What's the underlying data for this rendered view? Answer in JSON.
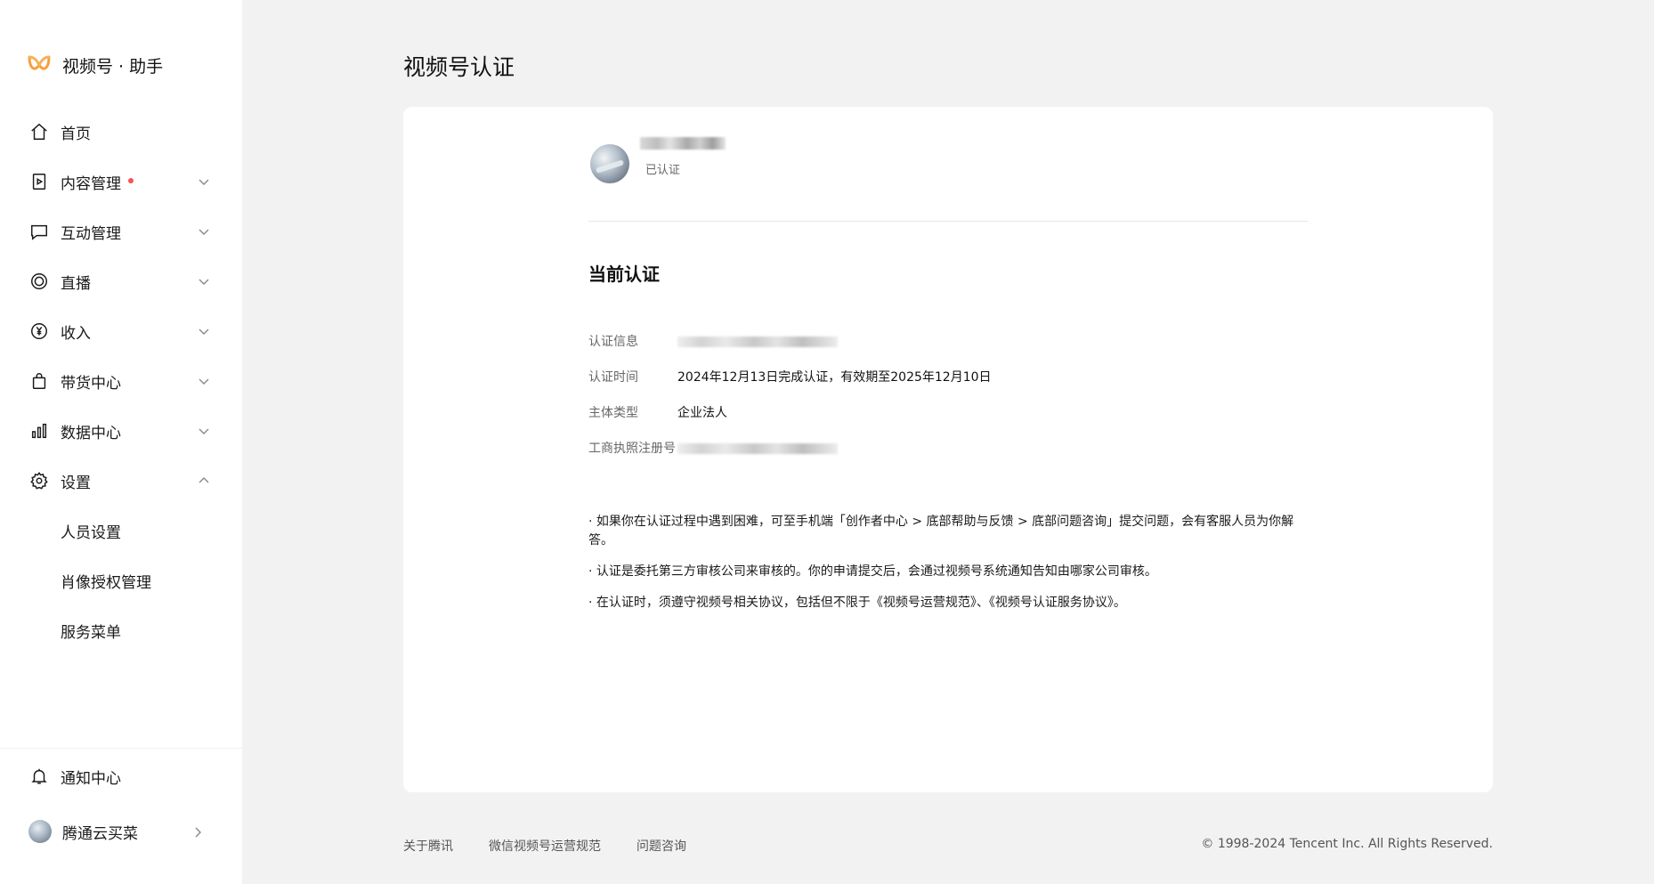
{
  "app": {
    "logo_text": "视频号 · 助手"
  },
  "sidebar": {
    "items": [
      {
        "label": "首页",
        "icon": "home-icon"
      },
      {
        "label": "内容管理",
        "icon": "content-icon",
        "badge": true
      },
      {
        "label": "互动管理",
        "icon": "comment-icon"
      },
      {
        "label": "直播",
        "icon": "live-icon"
      },
      {
        "label": "收入",
        "icon": "yen-icon"
      },
      {
        "label": "带货中心",
        "icon": "bag-icon"
      },
      {
        "label": "数据中心",
        "icon": "chart-icon"
      },
      {
        "label": "设置",
        "icon": "gear-icon",
        "expanded": true
      }
    ],
    "sub_items": [
      "人员设置",
      "肖像授权管理",
      "服务菜单"
    ],
    "bottom": {
      "notification": "通知中心",
      "account": "腾通云买菜"
    }
  },
  "main": {
    "page_title": "视频号认证",
    "profile": {
      "status": "已认证"
    },
    "section_title": "当前认证",
    "rows": [
      {
        "label": "认证信息",
        "value": ""
      },
      {
        "label": "认证时间",
        "value": "2024年12月13日完成认证，有效期至2025年12月10日"
      },
      {
        "label": "主体类型",
        "value": "企业法人"
      },
      {
        "label": "工商执照注册号",
        "value": ""
      }
    ],
    "notes": [
      "· 如果你在认证过程中遇到困难，可至手机端「创作者中心 > 底部帮助与反馈 > 底部问题咨询」提交问题，会有客服人员为你解答。",
      "· 认证是委托第三方审核公司来审核的。你的申请提交后，会通过视频号系统通知告知由哪家公司审核。",
      "· 在认证时，须遵守视频号相关协议，包括但不限于《视频号运营规范》、《视频号认证服务协议》。"
    ]
  },
  "footer": {
    "links": [
      "关于腾讯",
      "微信视频号运营规范",
      "问题咨询"
    ],
    "copyright": "© 1998-2024 Tencent Inc. All Rights Reserved."
  },
  "colors": {
    "accent": "#fa9d3b",
    "badge": "#fa5151",
    "background": "#f2f2f2"
  }
}
